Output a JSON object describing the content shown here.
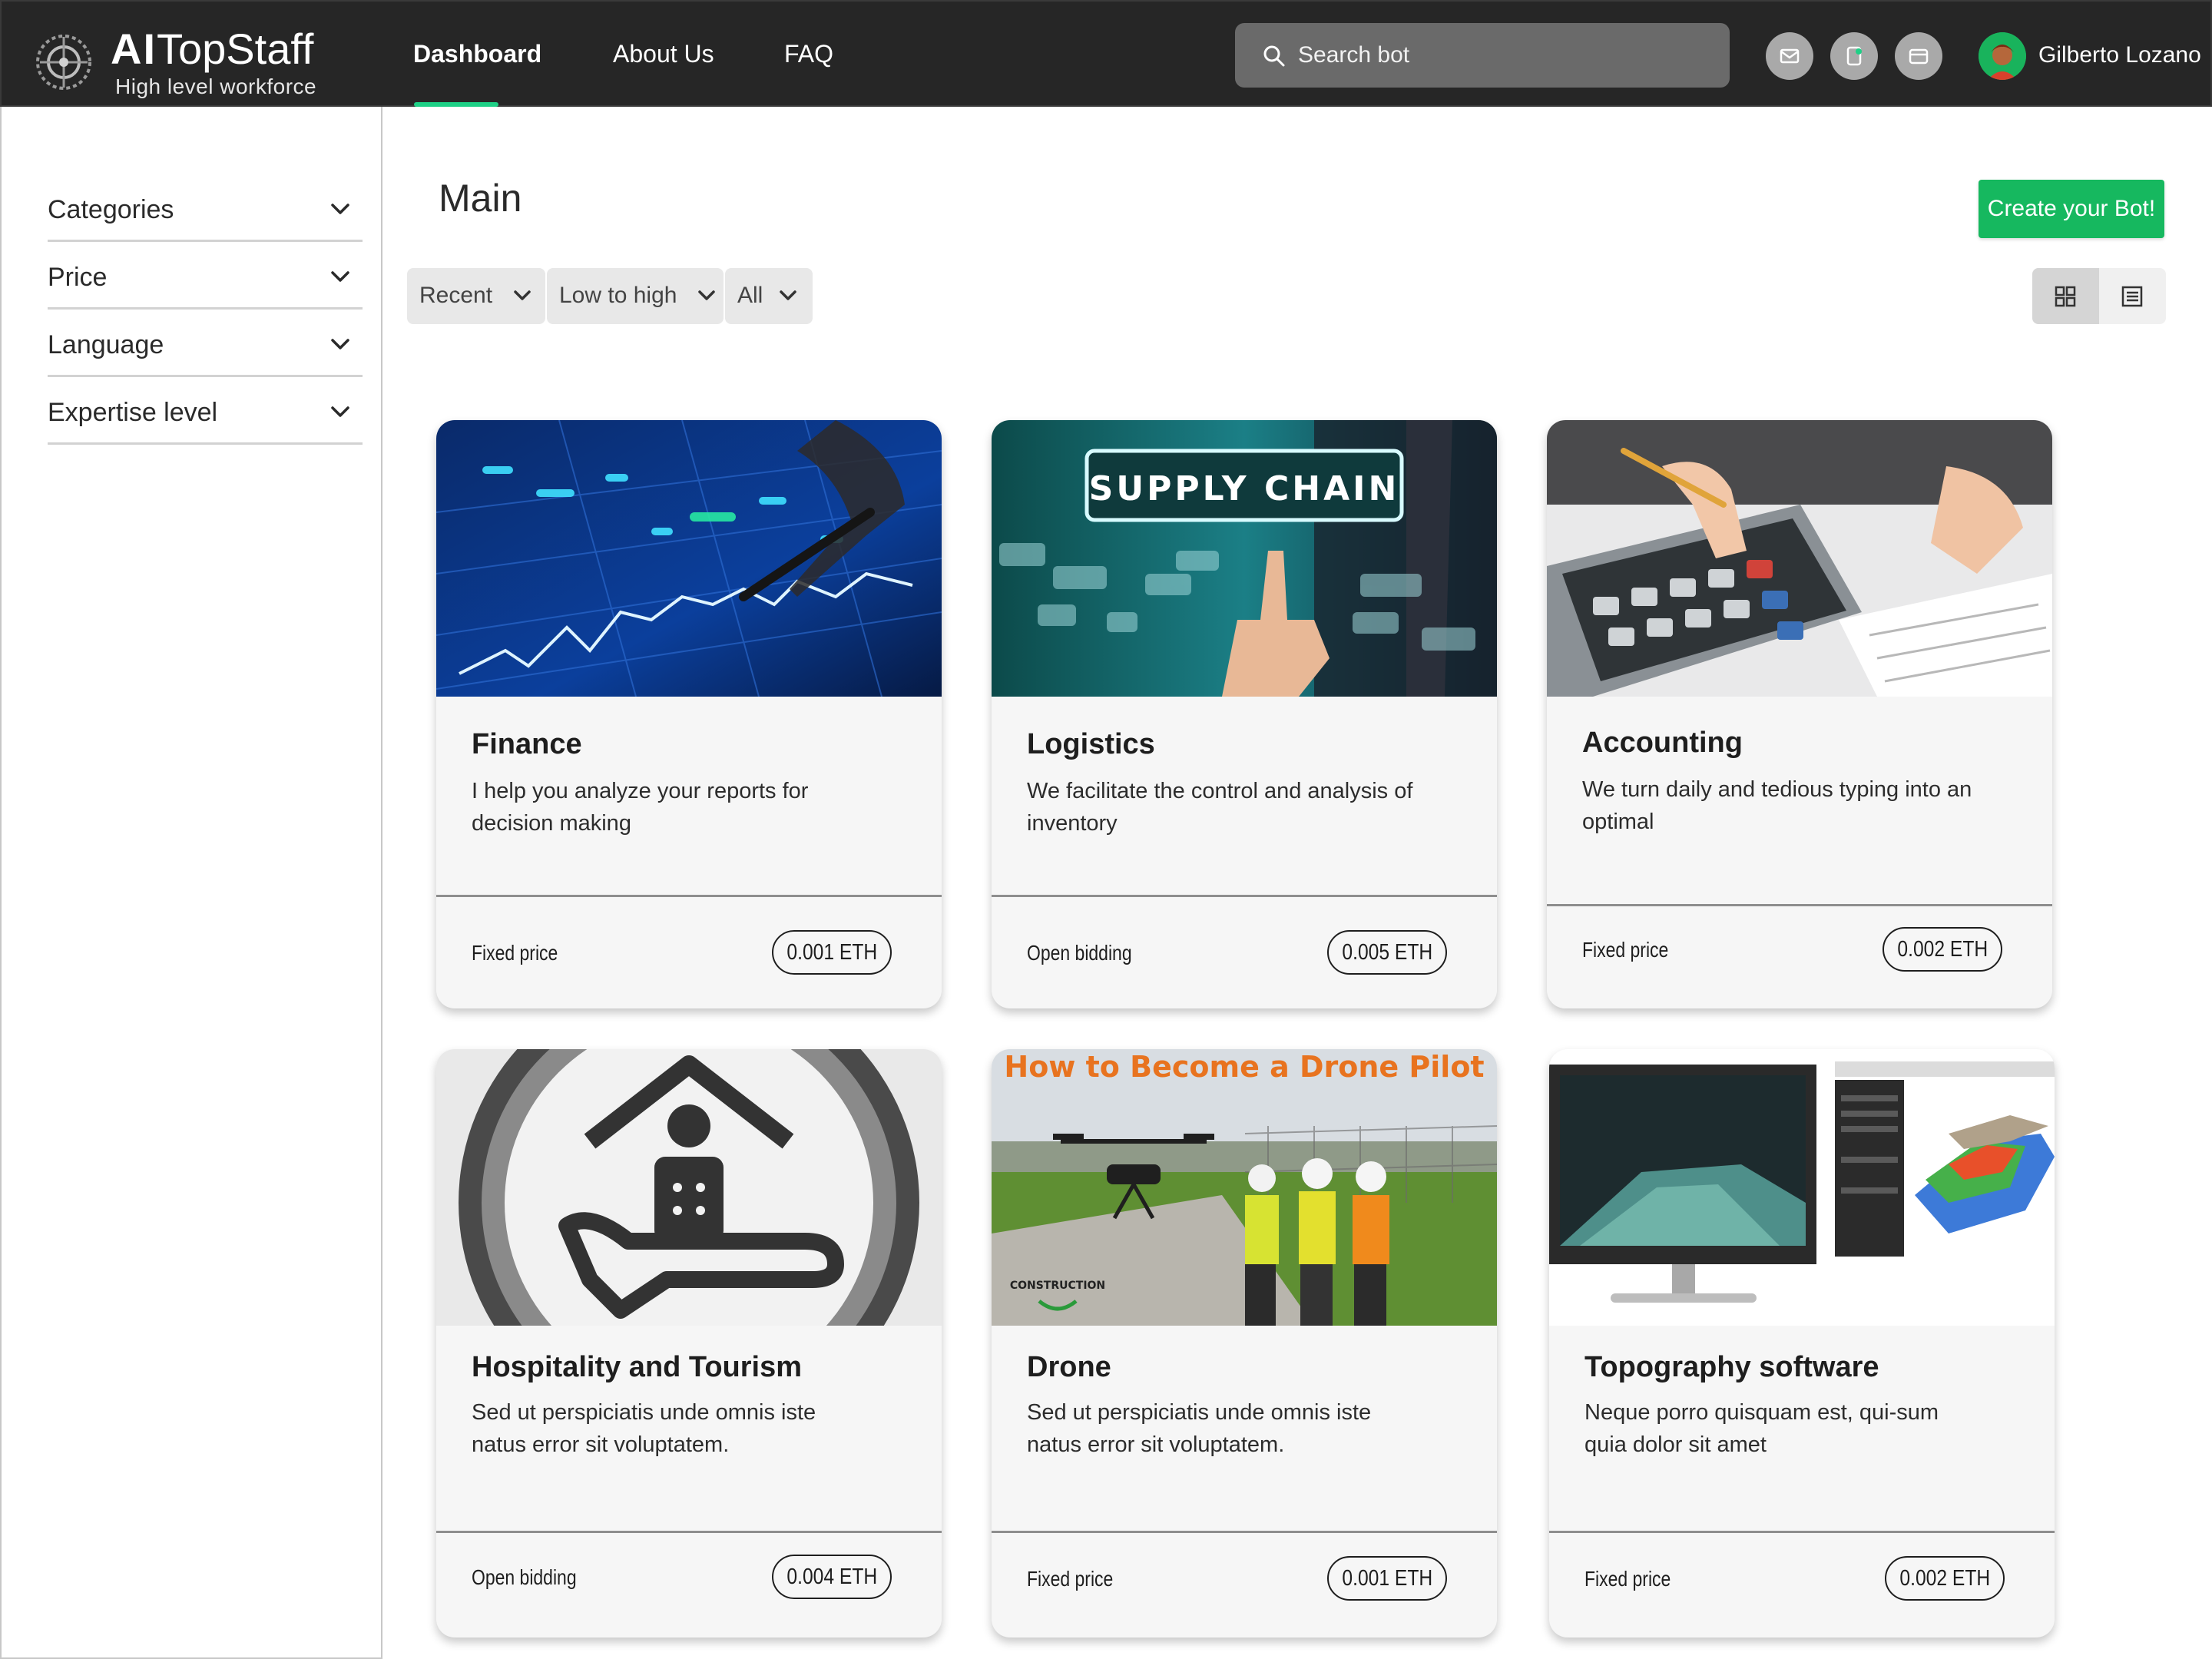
{
  "app": {
    "brand_bold": "AI",
    "brand_rest": "TopStaff",
    "tagline": "High level workforce"
  },
  "nav": {
    "items": [
      {
        "label": "Dashboard",
        "active": true
      },
      {
        "label": "About Us",
        "active": false
      },
      {
        "label": "FAQ",
        "active": false
      }
    ]
  },
  "search": {
    "placeholder": "Search bot"
  },
  "header_icons": [
    "mail-icon",
    "mobile-icon",
    "wallet-icon"
  ],
  "user": {
    "name": "Gilberto Lozano"
  },
  "sidebar": {
    "filters": [
      {
        "label": "Categories"
      },
      {
        "label": "Price"
      },
      {
        "label": "Language"
      },
      {
        "label": "Expertise level"
      }
    ]
  },
  "main": {
    "title": "Main",
    "create_button": "Create your Bot!",
    "sort": {
      "recency": "Recent",
      "price_order": "Low to high",
      "scope": "All"
    },
    "view_mode": "grid"
  },
  "colors": {
    "topbar": "#262626",
    "accent": "#1ed086",
    "create_button": "#16b85f"
  },
  "cards": [
    {
      "title": "Finance",
      "desc": "I help you analyze your reports for decision making",
      "price_type": "Fixed price",
      "price": "0.001 ETH",
      "image": "finance-chart-image"
    },
    {
      "title": "Logistics",
      "desc": "We facilitate the control and analysis of inventory",
      "price_type": "Open bidding",
      "price": "0.005 ETH",
      "image": "supply-chain-image",
      "image_text": "SUPPLY CHAIN"
    },
    {
      "title": "Accounting",
      "desc": "We turn daily and tedious typing into an optimal",
      "price_type": "Fixed price",
      "price": "0.002 ETH",
      "image": "calculator-image"
    },
    {
      "title": "Hospitality and Tourism",
      "desc": "Sed ut perspiciatis unde omnis iste natus error sit voluptatem.",
      "price_type": "Open bidding",
      "price": "0.004 ETH",
      "image": "hospitality-icon-image"
    },
    {
      "title": "Drone",
      "desc": "Sed ut perspiciatis unde omnis iste natus error sit voluptatem.",
      "price_type": "Fixed price",
      "price": "0.001 ETH",
      "image": "drone-image",
      "image_text": "How to Become a Drone Pilot",
      "image_logo_text": "CONSTRUCTION"
    },
    {
      "title": "Topography software",
      "desc": "Neque porro quisquam est, qui-sum quia dolor sit amet",
      "price_type": "Fixed price",
      "price": "0.002 ETH",
      "image": "topography-monitor-image"
    }
  ]
}
